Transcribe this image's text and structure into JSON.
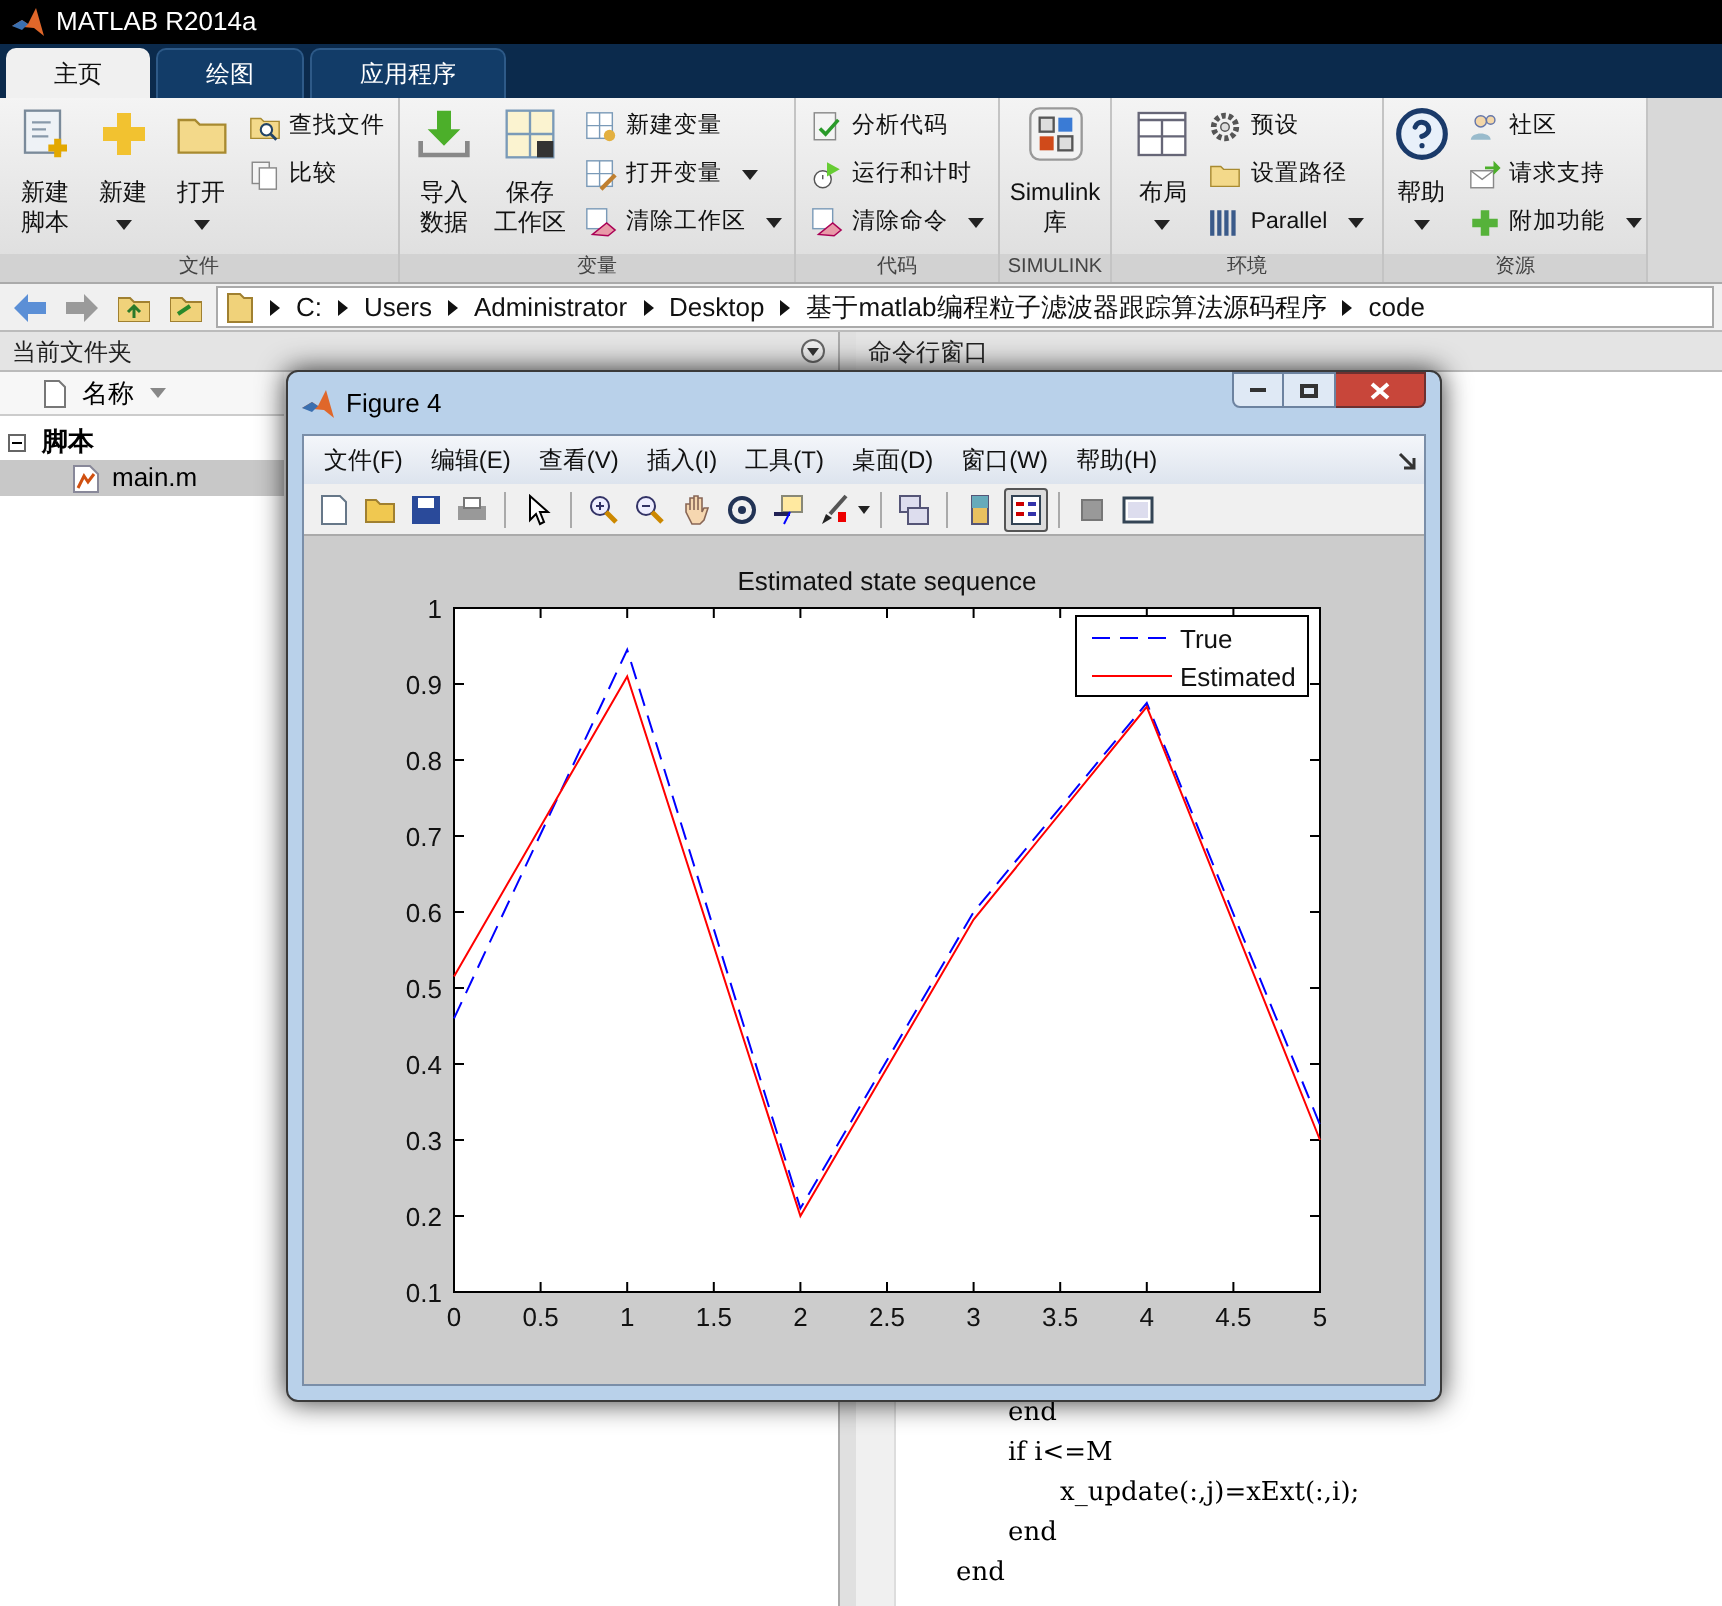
{
  "window": {
    "title": "MATLAB R2014a"
  },
  "tabs": [
    {
      "label": "主页",
      "selected": true
    },
    {
      "label": "绘图",
      "selected": false
    },
    {
      "label": "应用程序",
      "selected": false
    }
  ],
  "ribbon": [
    {
      "title": "文件",
      "items": [
        {
          "kind": "large",
          "label": [
            "新建",
            "脚本"
          ],
          "dropdown": false
        },
        {
          "kind": "large",
          "label": [
            "新建"
          ],
          "dropdown": true
        },
        {
          "kind": "large",
          "label": [
            "打开"
          ],
          "dropdown": true
        },
        {
          "kind": "stack",
          "entries": [
            {
              "label": "查找文件",
              "dropdown": false
            },
            {
              "label": "比较",
              "dropdown": false
            }
          ]
        }
      ]
    },
    {
      "title": "变量",
      "items": [
        {
          "kind": "large",
          "label": [
            "导入",
            "数据"
          ],
          "dropdown": false
        },
        {
          "kind": "large",
          "label": [
            "保存",
            "工作区"
          ],
          "dropdown": false
        },
        {
          "kind": "stack",
          "entries": [
            {
              "label": "新建变量",
              "dropdown": false
            },
            {
              "label": "打开变量",
              "dropdown": true
            },
            {
              "label": "清除工作区",
              "dropdown": true
            }
          ]
        }
      ]
    },
    {
      "title": "代码",
      "items": [
        {
          "kind": "stack",
          "entries": [
            {
              "label": "分析代码",
              "dropdown": false
            },
            {
              "label": "运行和计时",
              "dropdown": false
            },
            {
              "label": "清除命令",
              "dropdown": true
            }
          ]
        }
      ]
    },
    {
      "title": "SIMULINK",
      "items": [
        {
          "kind": "large",
          "label": [
            "Simulink",
            "库"
          ],
          "dropdown": false
        }
      ]
    },
    {
      "title": "环境",
      "items": [
        {
          "kind": "large",
          "label": [
            "布局"
          ],
          "dropdown": true
        },
        {
          "kind": "stack",
          "entries": [
            {
              "label": "预设",
              "dropdown": false
            },
            {
              "label": "设置路径",
              "dropdown": false
            },
            {
              "label": "Parallel",
              "dropdown": true
            }
          ]
        }
      ]
    },
    {
      "title": "资源",
      "items": [
        {
          "kind": "large",
          "label": [
            "帮助"
          ],
          "dropdown": true
        },
        {
          "kind": "stack",
          "entries": [
            {
              "label": "社区",
              "dropdown": false
            },
            {
              "label": "请求支持",
              "dropdown": false
            },
            {
              "label": "附加功能",
              "dropdown": true
            }
          ]
        }
      ]
    }
  ],
  "address_bar": {
    "path": [
      "C:",
      "Users",
      "Administrator",
      "Desktop",
      "基于matlab编程粒子滤波器跟踪算法源码程序",
      "code"
    ]
  },
  "current_folder": {
    "title": "当前文件夹",
    "column": "名称",
    "tree": [
      {
        "label": "脚本",
        "expanded": true,
        "selected": false,
        "children": [
          {
            "label": "main.m",
            "selected": true
          }
        ]
      }
    ]
  },
  "command_window": {
    "title": "命令行窗口",
    "code": [
      {
        "children": [
          {
            "text": "end"
          },
          {
            "text": "if i<=M",
            "children": [
              {
                "text": "x_update(:,j)=xExt(:,i);"
              }
            ]
          },
          {
            "text": "end"
          }
        ]
      },
      {
        "text": "end"
      }
    ]
  },
  "figure": {
    "title": "Figure 4",
    "menus": [
      "文件(F)",
      "编辑(E)",
      "查看(V)",
      "插入(I)",
      "工具(T)",
      "桌面(D)",
      "窗口(W)",
      "帮助(H)"
    ],
    "chart_data": {
      "type": "line",
      "title": "Estimated state sequence",
      "x": [
        0,
        1,
        2,
        3,
        4,
        5
      ],
      "xlim": [
        0,
        5
      ],
      "ylim": [
        0.1,
        1
      ],
      "xticks": [
        0,
        0.5,
        1,
        1.5,
        2,
        2.5,
        3,
        3.5,
        4,
        4.5,
        5
      ],
      "yticks": [
        0.1,
        0.2,
        0.3,
        0.4,
        0.5,
        0.6,
        0.7,
        0.8,
        0.9,
        1
      ],
      "legend": "upper right",
      "series": [
        {
          "name": "True",
          "color": "#0000ff",
          "line_style": "dashed",
          "values": [
            0.46,
            0.945,
            0.21,
            0.6,
            0.875,
            0.32
          ]
        },
        {
          "name": "Estimated",
          "color": "#ff0000",
          "line_style": "solid",
          "values": [
            0.515,
            0.91,
            0.2,
            0.59,
            0.87,
            0.3
          ]
        }
      ]
    }
  }
}
